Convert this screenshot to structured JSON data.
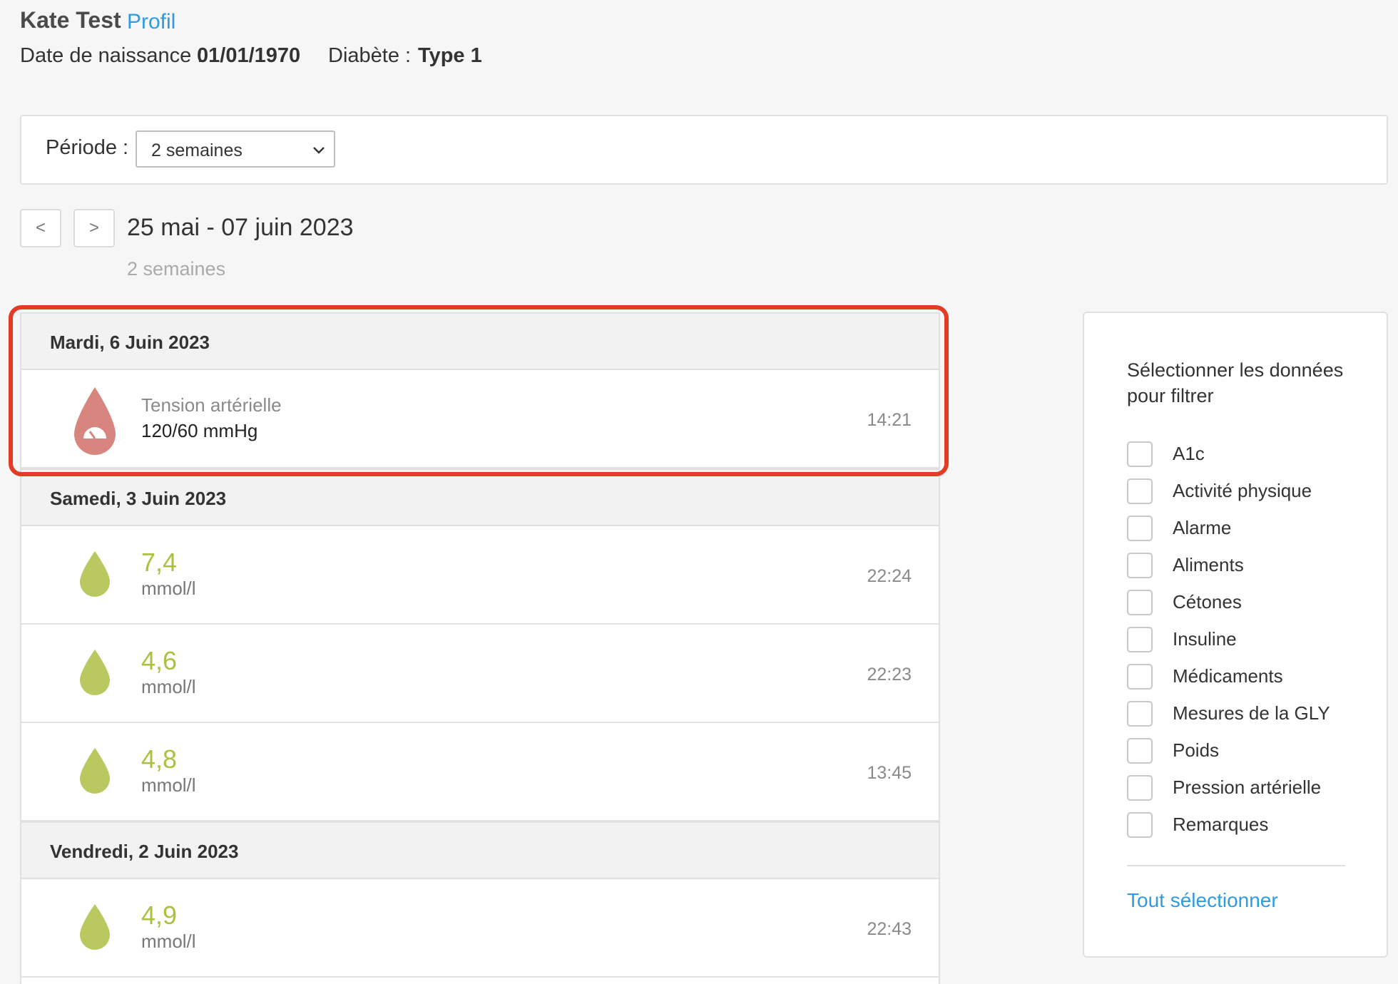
{
  "patient": {
    "name": "Kate Test",
    "profile_link": "Profil",
    "dob_label": "Date de naissance :",
    "dob_value": "01/01/1970",
    "diabetes_label": "Diabète :",
    "diabetes_value": "Type 1"
  },
  "period": {
    "label": "Période :",
    "selected": "2 semaines"
  },
  "range": {
    "prev_label": "<",
    "next_label": ">",
    "title": "25 mai - 07 juin 2023",
    "subtitle": "2 semaines"
  },
  "days": [
    {
      "date": "Mardi, 6 Juin 2023",
      "entries": [
        {
          "type": "blood-pressure",
          "label": "Tension artérielle",
          "value": "120/60 mmHg",
          "time": "14:21"
        }
      ]
    },
    {
      "date": "Samedi, 3 Juin 2023",
      "entries": [
        {
          "type": "glucose",
          "value": "7,4",
          "unit": "mmol/l",
          "time": "22:24"
        },
        {
          "type": "glucose",
          "value": "4,6",
          "unit": "mmol/l",
          "time": "22:23"
        },
        {
          "type": "glucose",
          "value": "4,8",
          "unit": "mmol/l",
          "time": "13:45"
        }
      ]
    },
    {
      "date": "Vendredi, 2 Juin 2023",
      "entries": [
        {
          "type": "glucose",
          "value": "4,9",
          "unit": "mmol/l",
          "time": "22:43"
        }
      ]
    }
  ],
  "filter": {
    "title": "Sélectionner les données pour filtrer",
    "options": [
      {
        "label": "A1c",
        "checked": false
      },
      {
        "label": "Activité physique",
        "checked": false
      },
      {
        "label": "Alarme",
        "checked": false
      },
      {
        "label": "Aliments",
        "checked": false
      },
      {
        "label": "Cétones",
        "checked": false
      },
      {
        "label": "Insuline",
        "checked": false
      },
      {
        "label": "Médicaments",
        "checked": false
      },
      {
        "label": "Mesures de la GLY",
        "checked": false
      },
      {
        "label": "Poids",
        "checked": false
      },
      {
        "label": "Pression artérielle",
        "checked": false
      },
      {
        "label": "Remarques",
        "checked": false
      }
    ],
    "select_all": "Tout sélectionner"
  },
  "colors": {
    "accent": "#2f9be0",
    "glucose": "#b9c95f",
    "glucose_text": "#a9c23f",
    "blood_pressure": "#d9857f",
    "highlight": "#e33b26"
  },
  "icons": {
    "blood_pressure": "blood-pressure-drop-icon",
    "glucose": "glucose-drop-icon",
    "dropdown": "chevron-down-icon"
  }
}
